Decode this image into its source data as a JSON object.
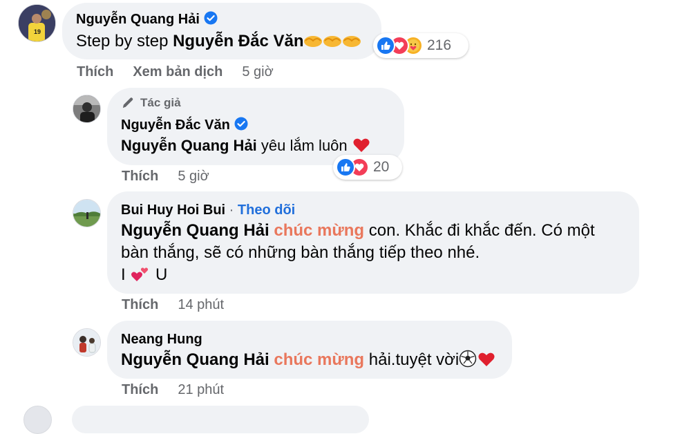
{
  "comments": [
    {
      "author": "Nguyễn Quang Hải",
      "text_plain": "Step by step ",
      "mention": "Nguyễn Đắc Văn",
      "reaction_count": "216",
      "actions": {
        "like": "Thích",
        "translate": "Xem bản dịch",
        "time": "5 giờ"
      }
    },
    {
      "author_badge": "Tác giả",
      "author": "Nguyễn Đắc Văn",
      "mention": "Nguyễn Quang Hải",
      "text_plain": " yêu lắm luôn ",
      "reaction_count": "20",
      "actions": {
        "like": "Thích",
        "time": "5 giờ"
      }
    },
    {
      "author": "Bui Huy Hoi Bui",
      "follow_sep": " · ",
      "follow": "Theo dõi",
      "mention": "Nguyễn Quang Hải",
      "keyword": "chúc mừng",
      "text_line1_rest": " con. Khắc đi khắc đến. Có một",
      "text_line2": "bàn thắng, sẽ có những bàn thắng tiếp theo nhé.",
      "text_line3_a": "I ",
      "text_line3_b": " U",
      "actions": {
        "like": "Thích",
        "time": "14 phút"
      }
    },
    {
      "author": "Neang Hung",
      "mention": "Nguyễn Quang Hải",
      "keyword": "chúc mừng",
      "text_rest": " hải.tuyệt vời",
      "actions": {
        "like": "Thích",
        "time": "21 phút"
      }
    }
  ],
  "colors": {
    "bubble": "#f0f2f5",
    "keyword": "#e9775c",
    "link": "#216fdb",
    "like_blue": "#1877f2",
    "love_red": "#f33e58",
    "secondary_text": "#65676b"
  },
  "icons": [
    "verified-badge-icon",
    "handshake-emoji",
    "like-reaction-icon",
    "love-reaction-icon",
    "care-reaction-icon",
    "pencil-icon",
    "heart-emoji",
    "two-hearts-emoji",
    "soccer-ball-emoji"
  ]
}
